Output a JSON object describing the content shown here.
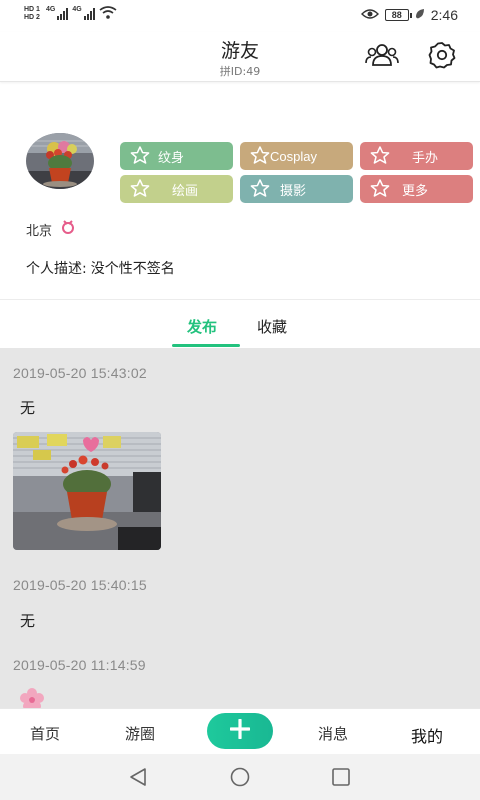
{
  "status_bar": {
    "hd1": "HD 1",
    "hd2": "HD 2",
    "network1": "4G",
    "network2": "4G",
    "battery": "88",
    "time": "2:46",
    "icons": [
      "signal-icon",
      "wifi-icon",
      "eye-icon",
      "battery-icon",
      "leaf-icon"
    ]
  },
  "header": {
    "title": "游友",
    "subtitle": "拼ID:49",
    "icons": [
      "friends-icon",
      "settings-icon"
    ]
  },
  "profile": {
    "location": "北京",
    "gender_icon": "female-icon",
    "description_label": "个人描述:",
    "description_value": "没个性不签名",
    "tags": [
      {
        "label": "纹身",
        "color": "#7dbd8f"
      },
      {
        "label": "Cosplay",
        "color": "#c7a97c"
      },
      {
        "label": "手办",
        "color": "#dc7f7f"
      },
      {
        "label": "绘画",
        "color": "#c2d08c"
      },
      {
        "label": "摄影",
        "color": "#7fb2ae"
      },
      {
        "label": "更多",
        "color": "#dc7f7f"
      }
    ]
  },
  "tabs": {
    "post": "发布",
    "favorite": "收藏",
    "active": "post",
    "accent": "#23c27e"
  },
  "posts": [
    {
      "time": "2019-05-20 15:43:02",
      "text": "无",
      "has_image": true
    },
    {
      "time": "2019-05-20 15:40:15",
      "text": "无",
      "has_image": false
    },
    {
      "time": "2019-05-20 11:14:59",
      "text": "",
      "emoji_icon": "cherry-blossom-icon"
    }
  ],
  "bottom_nav": {
    "home": "首页",
    "circle": "游圈",
    "add_icon": "plus-icon",
    "messages": "消息",
    "me": "我的"
  },
  "system_nav": [
    "back-icon",
    "home-icon",
    "recents-icon"
  ]
}
